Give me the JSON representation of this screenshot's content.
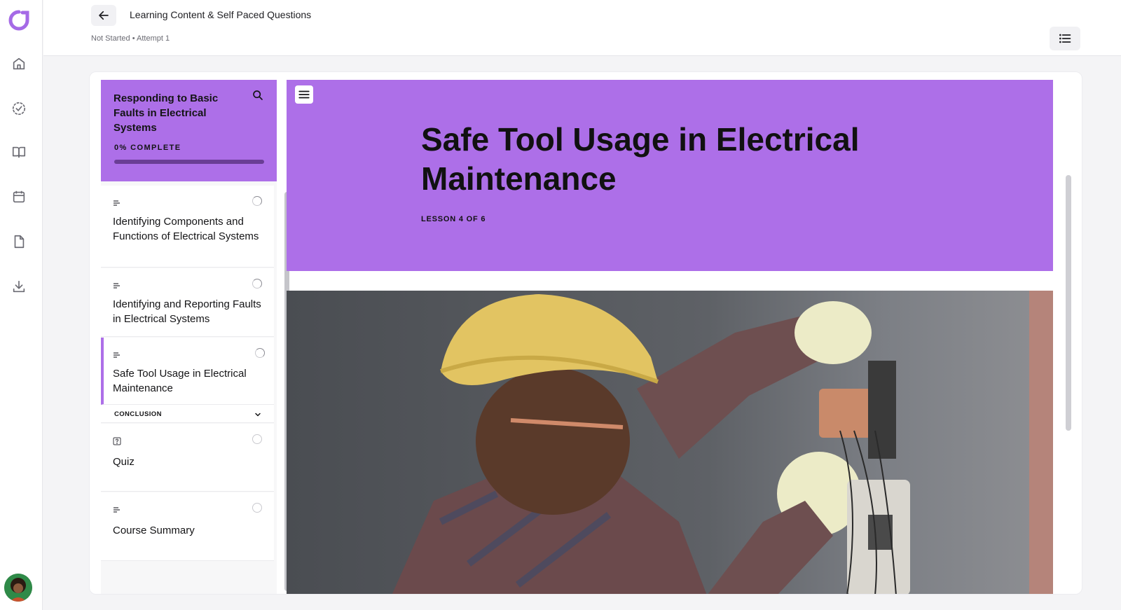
{
  "app": {
    "brand": "brand-logo",
    "accent_color": "#ad6fe8"
  },
  "rail": {
    "items": [
      {
        "name": "home",
        "icon": "home-icon"
      },
      {
        "name": "tasks",
        "icon": "check-badge-icon"
      },
      {
        "name": "library",
        "icon": "book-icon"
      },
      {
        "name": "calendar",
        "icon": "calendar-icon"
      },
      {
        "name": "documents",
        "icon": "document-icon"
      },
      {
        "name": "downloads",
        "icon": "download-icon"
      }
    ],
    "avatar": "user-avatar"
  },
  "header": {
    "title": "Learning Content & Self Paced Questions",
    "status": "Not Started • Attempt 1"
  },
  "course": {
    "title": "Responding to Basic Faults in Electrical Systems",
    "progress_label": "0% COMPLETE",
    "progress_fraction": 0.0,
    "lessons": [
      {
        "title": "Identifying Components and Functions of Electrical Systems",
        "type": "text",
        "status": "in-progress"
      },
      {
        "title": "Identifying and Reporting Faults in Electrical Systems",
        "type": "text",
        "status": "in-progress"
      },
      {
        "title": "Safe Tool Usage in Electrical Maintenance",
        "type": "text",
        "status": "in-progress",
        "active": true
      }
    ],
    "section": {
      "title": "CONCLUSION",
      "items": [
        {
          "title": "Quiz",
          "type": "quiz",
          "status": "not-started"
        },
        {
          "title": "Course Summary",
          "type": "text",
          "status": "not-started"
        }
      ]
    }
  },
  "lesson": {
    "heading": "Safe Tool Usage in Electrical Maintenance",
    "counter": "LESSON 4 OF 6"
  }
}
